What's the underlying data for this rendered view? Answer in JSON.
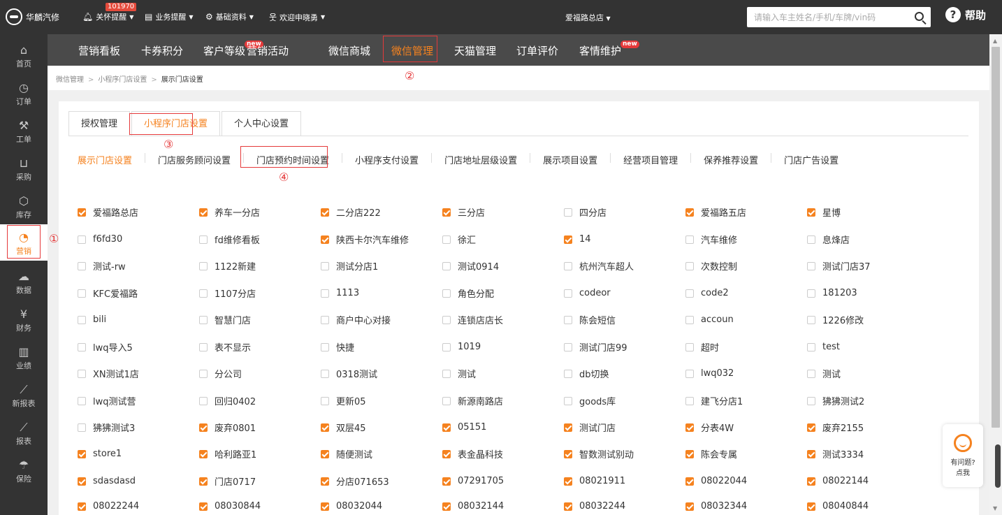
{
  "topbar": {
    "brand": "华麟汽修",
    "notify_count": "101970",
    "nav": [
      {
        "icon": "bell-icon",
        "label": "关怀提醒"
      },
      {
        "icon": "document-icon",
        "label": "业务提醒"
      },
      {
        "icon": "gear-icon",
        "label": "基础资料"
      },
      {
        "icon": "user-icon",
        "label": "欢迎申晓勇"
      }
    ],
    "store": "爱福路总店",
    "search_placeholder": "请输入车主姓名/手机/车牌/vin码",
    "help": "帮助"
  },
  "sidebar": {
    "items": [
      {
        "icon": "home-icon",
        "label": "首页"
      },
      {
        "icon": "clock-icon",
        "label": "订单"
      },
      {
        "icon": "wrench-icon",
        "label": "工单"
      },
      {
        "icon": "cart-icon",
        "label": "采购"
      },
      {
        "icon": "box-icon",
        "label": "库存"
      },
      {
        "icon": "pie-icon",
        "label": "营销"
      },
      {
        "icon": "cloud-icon",
        "label": "数据"
      },
      {
        "icon": "yen-icon",
        "label": "财务"
      },
      {
        "icon": "bar-icon",
        "label": "业绩"
      },
      {
        "icon": "line-chart-icon",
        "label": "新报表"
      },
      {
        "icon": "line-chart-icon",
        "label": "报表"
      },
      {
        "icon": "umbrella-icon",
        "label": "保险"
      }
    ]
  },
  "menu": {
    "items": [
      {
        "label": "营销看板",
        "new": ""
      },
      {
        "label": "卡券积分",
        "new": ""
      },
      {
        "label": "客户等级",
        "new": "new"
      },
      {
        "label": "营销活动",
        "new": ""
      },
      {
        "label": "微信商城",
        "new": ""
      },
      {
        "label": "微信管理",
        "new": ""
      },
      {
        "label": "天猫管理",
        "new": ""
      },
      {
        "label": "订单评价",
        "new": ""
      },
      {
        "label": "客情维护",
        "new": "new"
      }
    ]
  },
  "breadcrumb": {
    "items": [
      "微信管理",
      "小程序门店设置",
      "展示门店设置"
    ],
    "separator": ">"
  },
  "tabs": [
    "授权管理",
    "小程序门店设置",
    "个人中心设置"
  ],
  "subnav": [
    "展示门店设置",
    "门店服务顾问设置",
    "门店预约时间设置",
    "小程序支付设置",
    "门店地址层级设置",
    "展示项目设置",
    "经营项目管理",
    "保养推荐设置",
    "门店广告设置"
  ],
  "annotations": [
    "①",
    "②",
    "③",
    "④"
  ],
  "stores": [
    [
      [
        "爱福路总店",
        true
      ],
      [
        "养车一分店",
        true
      ],
      [
        "二分店222",
        true
      ],
      [
        "三分店",
        true
      ],
      [
        "四分店",
        false
      ],
      [
        "爱福路五店",
        true
      ],
      [
        "星博",
        true
      ]
    ],
    [
      [
        "f6fd30",
        false
      ],
      [
        "fd维修看板",
        false
      ],
      [
        "陕西卡尔汽车维修",
        true
      ],
      [
        "徐汇",
        false
      ],
      [
        "14",
        true
      ],
      [
        "汽车维修",
        false
      ],
      [
        "息烽店",
        false
      ]
    ],
    [
      [
        "测试-rw",
        false
      ],
      [
        "1122新建",
        false
      ],
      [
        "测试分店1",
        false
      ],
      [
        "测试0914",
        false
      ],
      [
        "杭州汽车超人",
        false
      ],
      [
        "次数控制",
        false
      ],
      [
        "测试门店37",
        false
      ]
    ],
    [
      [
        "KFC爱福路",
        false
      ],
      [
        "1107分店",
        false
      ],
      [
        "1113",
        false
      ],
      [
        "角色分配",
        false
      ],
      [
        "codeor",
        false
      ],
      [
        "code2",
        false
      ],
      [
        "181203",
        false
      ]
    ],
    [
      [
        "bili",
        false
      ],
      [
        "智慧门店",
        false
      ],
      [
        "商户中心对接",
        false
      ],
      [
        "连锁店店长",
        false
      ],
      [
        "陈会短信",
        false
      ],
      [
        "accoun",
        false
      ],
      [
        "1226修改",
        false
      ]
    ],
    [
      [
        "lwq导入5",
        false
      ],
      [
        "表不显示",
        false
      ],
      [
        "快捷",
        false
      ],
      [
        "1019",
        false
      ],
      [
        "测试门店99",
        false
      ],
      [
        "超时",
        false
      ],
      [
        "test",
        false
      ]
    ],
    [
      [
        "XN测试1店",
        false
      ],
      [
        "分公司",
        false
      ],
      [
        "0318测试",
        false
      ],
      [
        "测试",
        false
      ],
      [
        "db切换",
        false
      ],
      [
        "lwq032",
        false
      ],
      [
        "测试",
        false
      ]
    ],
    [
      [
        "lwq测试营",
        false
      ],
      [
        "回归0402",
        false
      ],
      [
        "更新05",
        false
      ],
      [
        "新源南路店",
        false
      ],
      [
        "goods库",
        false
      ],
      [
        "建飞分店1",
        false
      ],
      [
        "狒狒测试2",
        false
      ]
    ],
    [
      [
        "狒狒测试3",
        false
      ],
      [
        "废弃0801",
        true
      ],
      [
        "双层45",
        true
      ],
      [
        "05151",
        true
      ],
      [
        "测试门店",
        true
      ],
      [
        "分表4W",
        true
      ],
      [
        "废弃2155",
        true
      ]
    ],
    [
      [
        "store1",
        true
      ],
      [
        "哈利路亚1",
        true
      ],
      [
        "随便测试",
        true
      ],
      [
        "表金晶科技",
        true
      ],
      [
        "智数测试别动",
        true
      ],
      [
        "陈会专属",
        true
      ],
      [
        "测试3334",
        true
      ]
    ],
    [
      [
        "sdasdasd",
        true
      ],
      [
        "门店0717",
        true
      ],
      [
        "分店071653",
        true
      ],
      [
        "07291705",
        true
      ],
      [
        "08021911",
        true
      ],
      [
        "08022044",
        true
      ],
      [
        "08022144",
        true
      ]
    ],
    [
      [
        "08022244",
        true
      ],
      [
        "08030844",
        true
      ],
      [
        "08032044",
        true
      ],
      [
        "08032144",
        true
      ],
      [
        "08032244",
        true
      ],
      [
        "08032344",
        true
      ],
      [
        "08040844",
        true
      ]
    ]
  ],
  "float_help": {
    "line1": "有问题?",
    "line2": "点我"
  },
  "colors": {
    "accent": "#f5821f",
    "topbar": "#333333",
    "menubar": "#4a4a4a",
    "annotation": "#e5393a"
  }
}
